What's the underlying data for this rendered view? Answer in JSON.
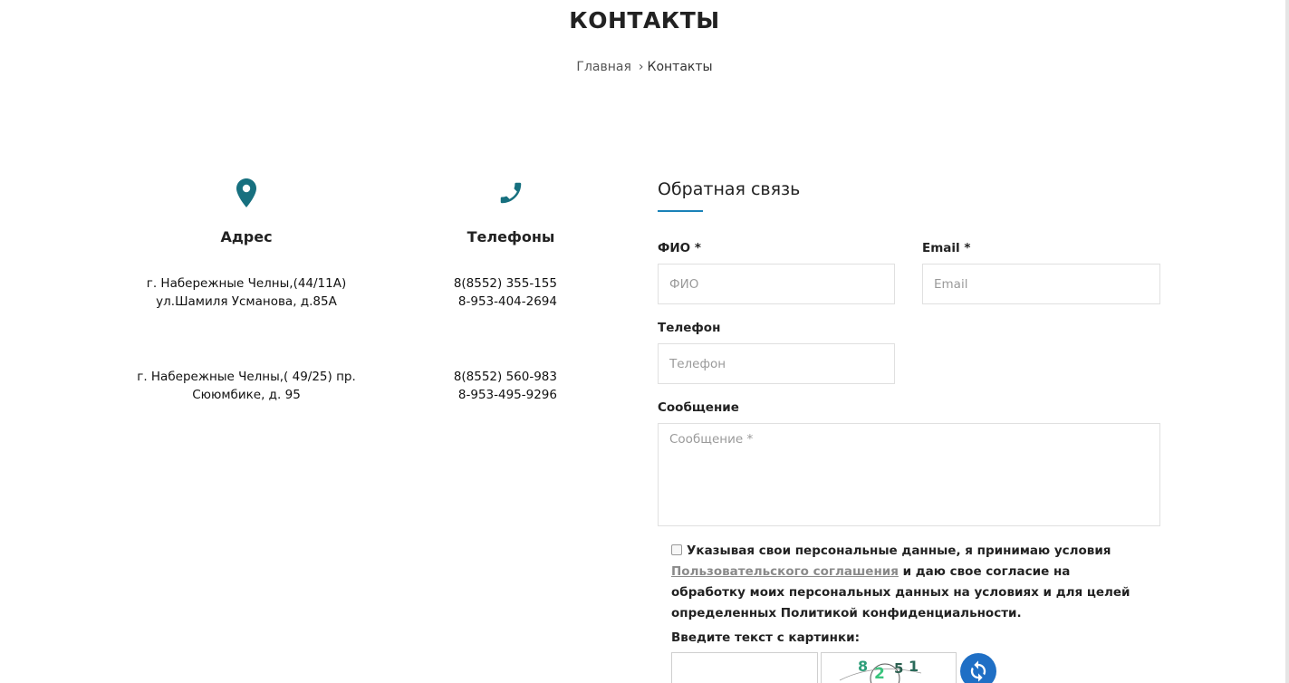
{
  "page": {
    "title": "КОНТАКТЫ",
    "accent_color": "#17707f"
  },
  "breadcrumb": {
    "home": "Главная",
    "separator": "›",
    "current": "Контакты"
  },
  "address": {
    "icon": "map-pin-icon",
    "heading": "Адрес",
    "blocks": [
      {
        "line1": "г. Набережные Челны,(44/11А)",
        "line2": "ул.Шамиля Усманова, д.85А"
      },
      {
        "line1": "г. Набережные Челны,( 49/25) пр.",
        "line2": "Сююмбике, д. 95"
      }
    ]
  },
  "phones": {
    "icon": "phone-icon",
    "heading": "Телефоны",
    "blocks": [
      {
        "line1": "8(8552) 355-155",
        "line2": "8-953-404-2694"
      },
      {
        "line1": "8(8552) 560-983",
        "line2": "8-953-495-9296"
      }
    ]
  },
  "form": {
    "title": "Обратная связь",
    "fio_label": "ФИО",
    "fio_placeholder": "ФИО",
    "email_label": "Email",
    "email_placeholder": "Email",
    "phone_label": "Телефон",
    "phone_placeholder": "Телефон",
    "message_label": "Сообщение",
    "message_placeholder": "Сообщение *",
    "required_mark": "*",
    "consent_part1": "Указывая свои персональные данные, я принимаю условия",
    "consent_link": "Пользовательского соглашения",
    "consent_part2": " и даю свое согласие на обработку моих персональных данных на условиях и для целей определенных Политикой конфиденциальности.",
    "captcha_label": "Введите текст с картинки:",
    "captcha_text": "8251"
  }
}
